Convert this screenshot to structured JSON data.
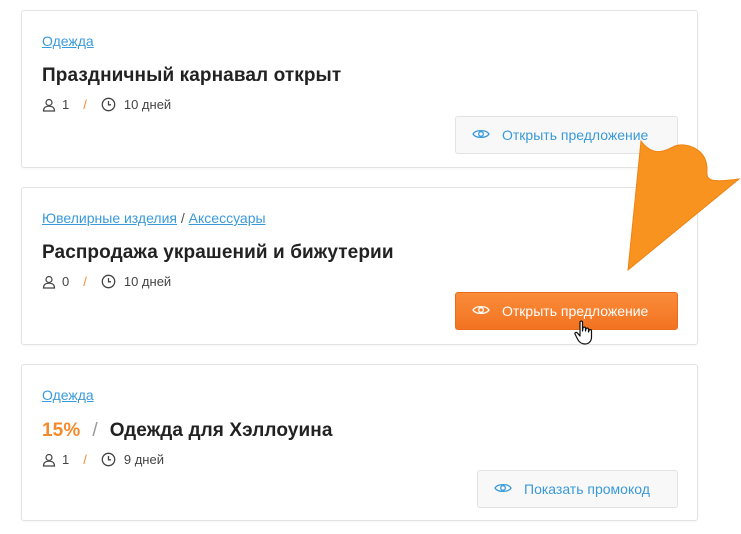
{
  "offers": [
    {
      "categories": [
        "Одежда"
      ],
      "title": "Праздничный карнавал открыт",
      "users_count": "1",
      "duration": "10 дней",
      "button_label": "Открыть предложение"
    },
    {
      "categories": [
        "Ювелирные изделия",
        "Аксессуары"
      ],
      "category_separator": "/",
      "title": "Распродажа украшений и бижутерии",
      "users_count": "0",
      "duration": "10 дней",
      "button_label": "Открыть предложение"
    },
    {
      "categories": [
        "Одежда"
      ],
      "discount": "15%",
      "title_separator": "/",
      "title": "Одежда для Хэллоуина",
      "users_count": "1",
      "duration": "9 дней",
      "button_label": "Показать промокод"
    }
  ],
  "meta_separator": "/",
  "icons": {
    "users": "user-icon",
    "clock": "clock-icon",
    "eye": "eye-icon",
    "cursor": "hand-pointer-icon",
    "arrow": "arrow-pointer-icon"
  },
  "colors": {
    "link": "#3a9ad9",
    "accent": "#f58a2c",
    "button_orange": "#f27321",
    "arrow": "#f7931e"
  }
}
